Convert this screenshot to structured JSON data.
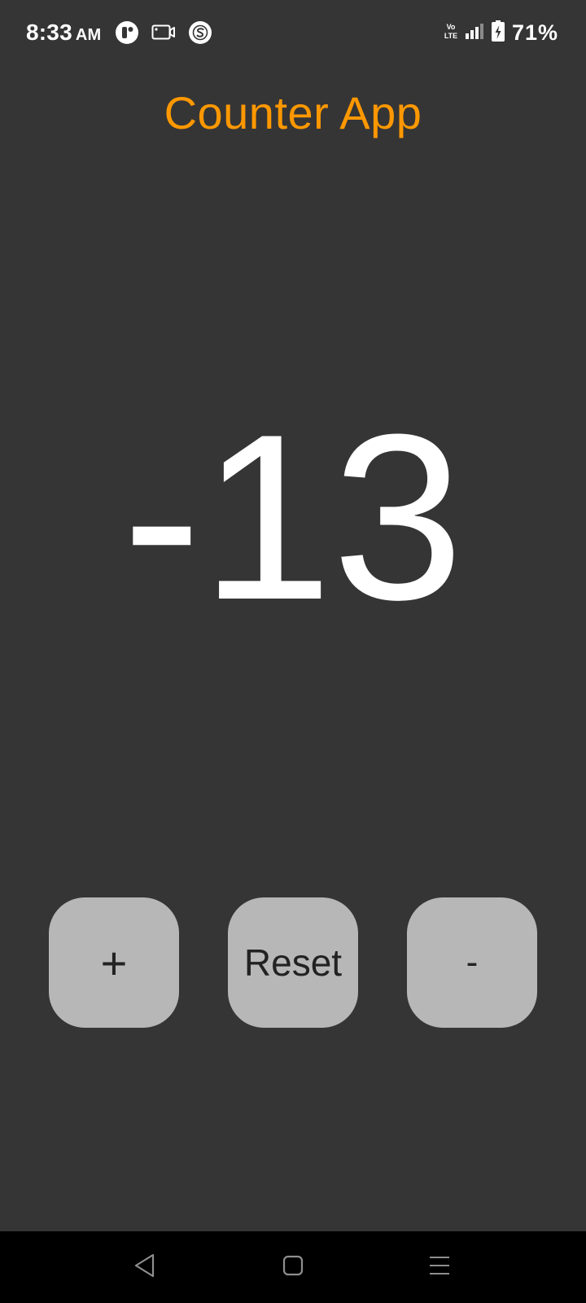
{
  "status_bar": {
    "time": "8:33",
    "ampm": "AM",
    "battery_percent": "71%",
    "network_label": "Vo LTE",
    "left_icons": [
      "app-circle-icon",
      "screen-record-icon",
      "s-circle-icon"
    ],
    "right_icons": [
      "volte-icon",
      "signal-icon",
      "battery-charging-icon"
    ]
  },
  "app": {
    "title": "Counter App",
    "counter_value": "-13",
    "title_color": "#ff9800"
  },
  "buttons": {
    "increment_label": "+",
    "reset_label": "Reset",
    "decrement_label": "-"
  },
  "nav_bar": {
    "icons": [
      "back-icon",
      "home-icon",
      "recents-icon"
    ]
  },
  "colors": {
    "background": "#353535",
    "button": "#b7b7b7",
    "accent": "#ff9800",
    "nav_background": "#000000"
  }
}
